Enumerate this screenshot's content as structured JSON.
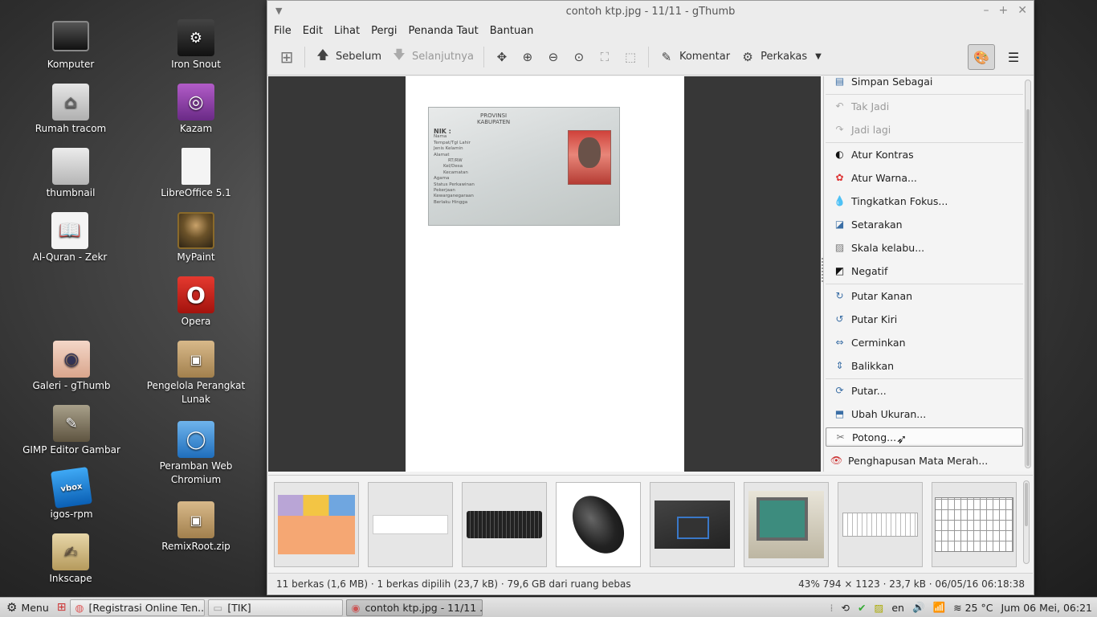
{
  "desktop": {
    "icons": [
      {
        "label": "Komputer"
      },
      {
        "label": "Rumah tracom"
      },
      {
        "label": "thumbnail"
      },
      {
        "label": "Al-Quran - Zekr"
      },
      {
        "label": "Galeri - gThumb"
      },
      {
        "label": "GIMP Editor Gambar"
      },
      {
        "label": "igos-rpm"
      },
      {
        "label": "Inkscape"
      },
      {
        "label": "Iron Snout"
      },
      {
        "label": "Kazam"
      },
      {
        "label": "LibreOffice 5.1"
      },
      {
        "label": "MyPaint"
      },
      {
        "label": "Opera"
      },
      {
        "label": "Pengelola Perangkat Lunak"
      },
      {
        "label": "Peramban Web Chromium"
      },
      {
        "label": "RemixRoot.zip"
      }
    ]
  },
  "window": {
    "title": "contoh ktp.jpg - 11/11 - gThumb",
    "menu": [
      "File",
      "Edit",
      "Lihat",
      "Pergi",
      "Penanda Taut",
      "Bantuan"
    ],
    "toolbar": {
      "prev": "Sebelum",
      "next": "Selanjutnya",
      "comment": "Komentar",
      "tools": "Perkakas"
    }
  },
  "ktp_image": {
    "header1": "PROVINSI",
    "header2": "KABUPATEN",
    "nik": "NIK   :",
    "fields": [
      "Nama",
      "Tempat/Tgl Lahir",
      "Jenis Kelamin",
      "Alamat",
      "RT/RW",
      "Kel/Desa",
      "Kecamatan",
      "Agama",
      "Status Perkawinan",
      "Pekerjaan",
      "Kewarganegaraan",
      "Berlaku Hingga"
    ]
  },
  "side_menu": {
    "items": [
      {
        "label": "Simpan Sebagai",
        "icon": "save-as-icon"
      },
      {
        "label": "Tak Jadi",
        "icon": "undo-icon"
      },
      {
        "label": "Jadi lagi",
        "icon": "redo-icon"
      },
      {
        "label": "Atur Kontras",
        "icon": "contrast-icon"
      },
      {
        "label": "Atur Warna...",
        "icon": "color-icon"
      },
      {
        "label": "Tingkatkan Fokus...",
        "icon": "sharpen-icon"
      },
      {
        "label": "Setarakan",
        "icon": "equalize-icon"
      },
      {
        "label": "Skala kelabu...",
        "icon": "grayscale-icon"
      },
      {
        "label": "Negatif",
        "icon": "negative-icon"
      },
      {
        "label": "Putar Kanan",
        "icon": "rotate-right-icon"
      },
      {
        "label": "Putar Kiri",
        "icon": "rotate-left-icon"
      },
      {
        "label": "Cerminkan",
        "icon": "mirror-icon"
      },
      {
        "label": "Balikkan",
        "icon": "flip-icon"
      },
      {
        "label": "Putar...",
        "icon": "rotate-icon"
      },
      {
        "label": "Ubah Ukuran...",
        "icon": "resize-icon"
      },
      {
        "label": "Potong...",
        "icon": "crop-icon"
      },
      {
        "label": "Penghapusan Mata Merah...",
        "icon": "red-eye-icon"
      }
    ]
  },
  "status": {
    "left": "11 berkas (1,6 MB) · 1 berkas dipilih (23,7 kB) · 79,6 GB dari ruang bebas",
    "right": "43%  794 × 1123 · 23,7 kB · 06/05/16 06:18:38"
  },
  "taskbar": {
    "menu": "Menu",
    "tasks": [
      "[Registrasi Online Ten...",
      "[TIK]",
      "contoh ktp.jpg - 11/11 ..."
    ],
    "lang": "en",
    "temp": "25 °C",
    "clock": "Jum 06 Mei, 06:21"
  }
}
